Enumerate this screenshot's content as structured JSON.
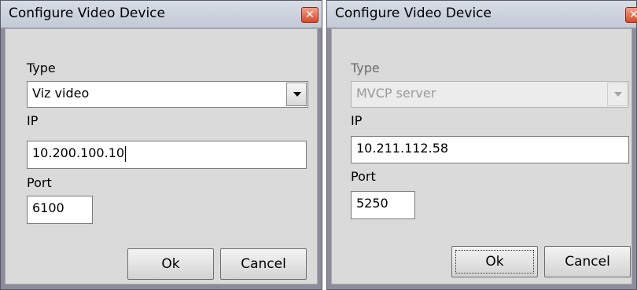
{
  "dialogs": [
    {
      "title": "Configure Video Device",
      "close_glyph": "✕",
      "type_label": "Type",
      "type_value": "Viz video",
      "type_enabled": true,
      "ip_label": "IP",
      "ip_value": "10.200.100.10",
      "port_label": "Port",
      "port_value": "6100",
      "ok_label": "Ok",
      "cancel_label": "Cancel"
    },
    {
      "title": "Configure Video Device",
      "close_glyph": "✕",
      "type_label": "Type",
      "type_value": "MVCP server",
      "type_enabled": false,
      "ip_label": "IP",
      "ip_value": "10.211.112.58",
      "port_label": "Port",
      "port_value": "5250",
      "ok_label": "Ok",
      "cancel_label": "Cancel"
    }
  ],
  "colors": {
    "frame": "#8c8c9c",
    "titlebar": "#c9d0dc",
    "client": "#dadada",
    "close_button": "#d64a2b",
    "disabled_text": "#9a9a9a"
  },
  "icons": {
    "close": "close-icon",
    "dropdown": "chevron-down-icon"
  }
}
